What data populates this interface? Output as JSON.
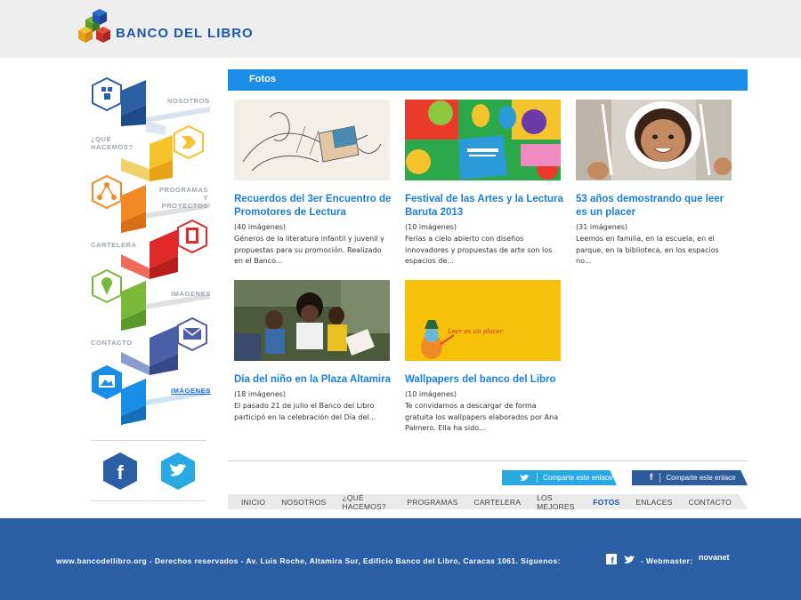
{
  "header": {
    "brand": "BANCO DEL LIBRO"
  },
  "sidebar": {
    "items": [
      {
        "label": "NOSOTROS",
        "icon": "team-icon"
      },
      {
        "label": "¿QUÉ HACEMOS?",
        "icon": "chevron-right-icon"
      },
      {
        "label": "PROGRAMAS Y PROYECTOS",
        "icon": "network-icon"
      },
      {
        "label": "CARTELERA",
        "icon": "board-icon"
      },
      {
        "label": "IMÁGENES",
        "icon": "award-icon"
      },
      {
        "label": "CONTACTO",
        "icon": "envelope-icon"
      },
      {
        "label": "IMÁGENES",
        "icon": "image-icon",
        "active": true
      }
    ],
    "social": {
      "facebook": "f",
      "twitter": "twitter-bird"
    }
  },
  "section": {
    "title": "Fotos"
  },
  "cards": [
    {
      "title": "Recuerdos del 3er Encuentro de Promotores de Lectura",
      "count": "(40 imágenes)",
      "desc": "Géneros de la literatura infantil y juvenil y propuestas para su promoción. Realizado en el Banco..."
    },
    {
      "title": "Festival de las Artes y la Lectura Baruta 2013",
      "count": "(10 imágenes)",
      "desc": "Ferias a cielo abierto con diseños innovadores y propuestas de arte son los espacios de..."
    },
    {
      "title": "53 años demostrando que leer es un placer",
      "count": "(31 imágenes)",
      "desc": "Leemos en familia, en la escuela, en el parque, en la biblioteca, en los espacios no..."
    },
    {
      "title": "Día del niño en la Plaza Altamira",
      "count": "(18 imágenes)",
      "desc": "El pasado 21 de julio el Banco del Libro participó en la celebración del Día del..."
    },
    {
      "title": "Wallpapers del banco del Libro",
      "count": "(10 imágenes)",
      "desc": "Te convidamos a descargar de forma gratuita los wallpapers elaborados por Ana Palmero. Ella ha sido...",
      "thumb_caption": "Leer es un placer"
    }
  ],
  "share": {
    "twitter": "Comparte este enlace",
    "facebook": "Comparte este enlace"
  },
  "bottom_nav": [
    {
      "label": "INICIO"
    },
    {
      "label": "NOSOTROS"
    },
    {
      "label": "¿QUÉ HACEMOS?"
    },
    {
      "label": "PROGRAMAS"
    },
    {
      "label": "CARTELERA"
    },
    {
      "label": "LOS MEJORES"
    },
    {
      "label": "FOTOS",
      "active": true
    },
    {
      "label": "ENLACES"
    },
    {
      "label": "CONTACTO"
    }
  ],
  "footer": {
    "text": "www.bancodellibro.org - Derechos reservados - Av. Luis Roche, Altamira Sur, Edificio Banco del Libro, Caracas 1061. Síguenos:",
    "webmaster": "- Webmaster:",
    "brand": "novanet"
  },
  "colors": {
    "primary": "#1a8de6",
    "dark_blue": "#2a5ea5",
    "twitter": "#29a9e1",
    "facebook": "#2c5c9c",
    "link": "#1a7fd4"
  }
}
